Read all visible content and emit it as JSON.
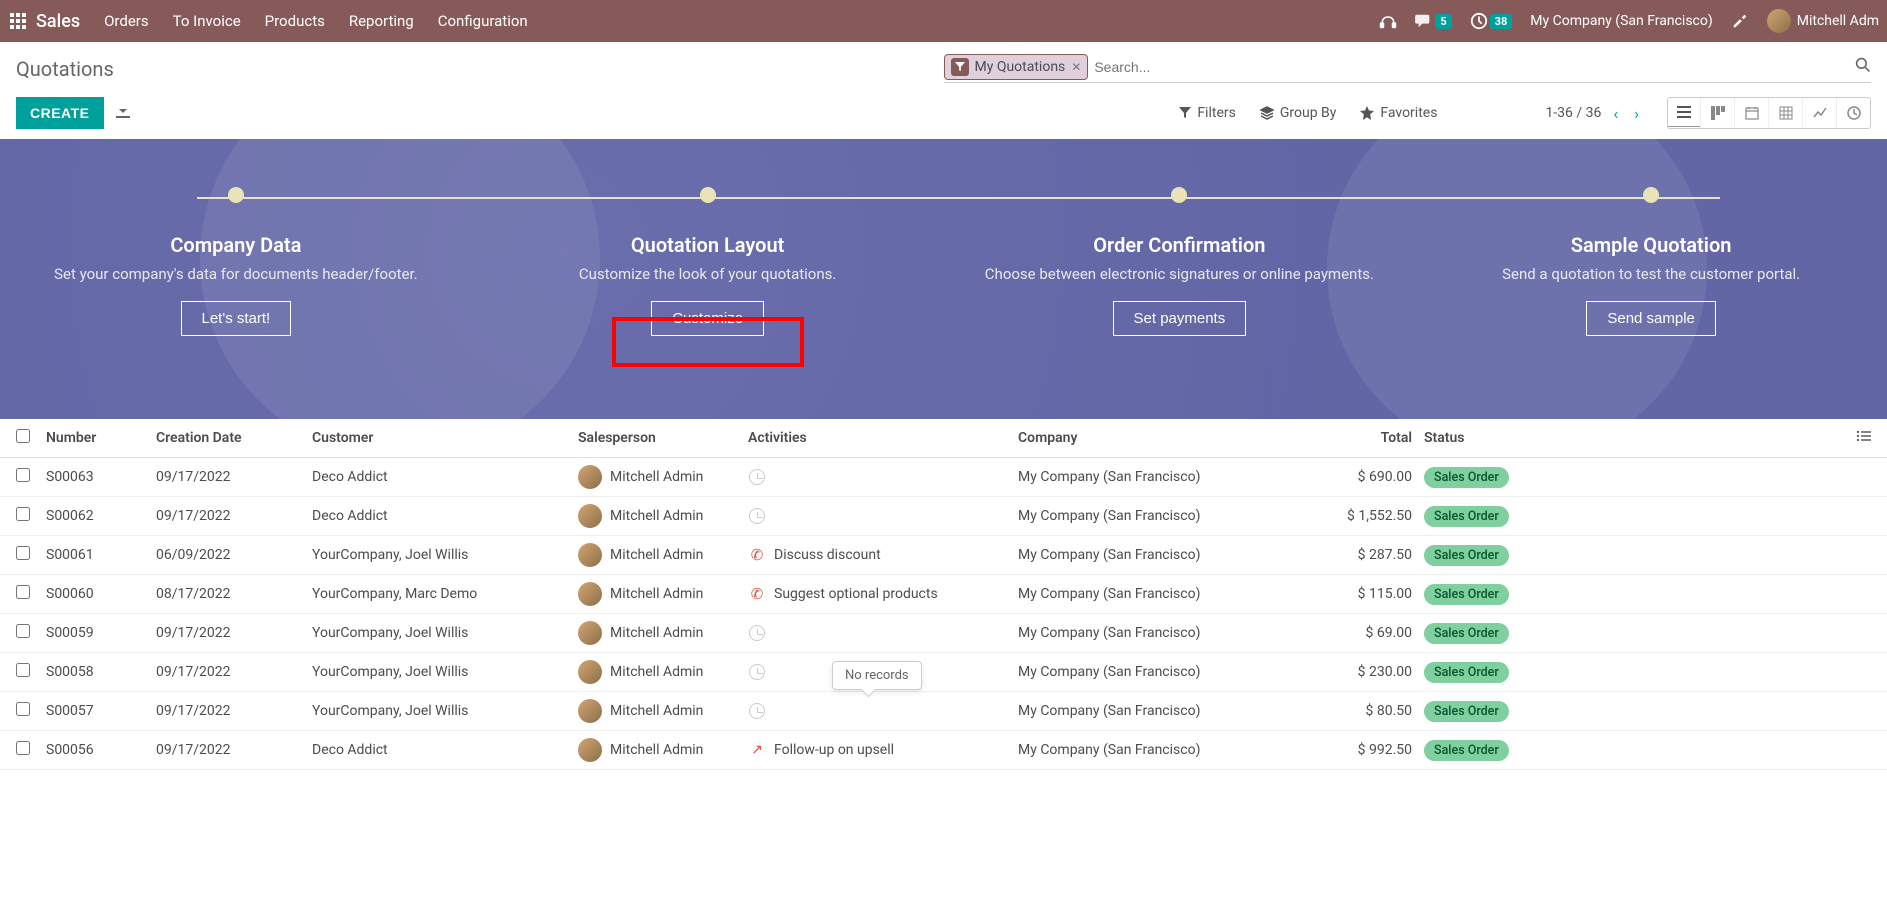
{
  "topbar": {
    "brand": "Sales",
    "menu": [
      "Orders",
      "To Invoice",
      "Products",
      "Reporting",
      "Configuration"
    ],
    "chat_badge": "5",
    "clock_badge": "38",
    "company": "My Company (San Francisco)",
    "user": "Mitchell Adm"
  },
  "page": {
    "title": "Quotations",
    "filter_chip": "My Quotations",
    "search_placeholder": "Search...",
    "create_label": "CREATE",
    "tools": {
      "filters": "Filters",
      "groupby": "Group By",
      "favorites": "Favorites"
    },
    "pager": "1-36 / 36"
  },
  "onboard": {
    "steps": [
      {
        "title": "Company Data",
        "desc": "Set your company's data for documents header/footer.",
        "btn": "Let's start!"
      },
      {
        "title": "Quotation Layout",
        "desc": "Customize the look of your quotations.",
        "btn": "Customize"
      },
      {
        "title": "Order Confirmation",
        "desc": "Choose between electronic signatures or online payments.",
        "btn": "Set payments"
      },
      {
        "title": "Sample Quotation",
        "desc": "Send a quotation to test the customer portal.",
        "btn": "Send sample"
      }
    ]
  },
  "columns": {
    "number": "Number",
    "date": "Creation Date",
    "customer": "Customer",
    "salesperson": "Salesperson",
    "activities": "Activities",
    "company": "Company",
    "total": "Total",
    "status": "Status"
  },
  "tooltip": "No records",
  "rows": [
    {
      "number": "S00063",
      "date": "09/17/2022",
      "customer": "Deco Addict",
      "salesperson": "Mitchell Admin",
      "activity_type": "clock",
      "activity_text": "",
      "company": "My Company (San Francisco)",
      "total": "$ 690.00",
      "status": "Sales Order"
    },
    {
      "number": "S00062",
      "date": "09/17/2022",
      "customer": "Deco Addict",
      "salesperson": "Mitchell Admin",
      "activity_type": "clock",
      "activity_text": "",
      "company": "My Company (San Francisco)",
      "total": "$ 1,552.50",
      "status": "Sales Order"
    },
    {
      "number": "S00061",
      "date": "06/09/2022",
      "customer": "YourCompany, Joel Willis",
      "salesperson": "Mitchell Admin",
      "activity_type": "phone",
      "activity_text": "Discuss discount",
      "company": "My Company (San Francisco)",
      "total": "$ 287.50",
      "status": "Sales Order"
    },
    {
      "number": "S00060",
      "date": "08/17/2022",
      "customer": "YourCompany, Marc Demo",
      "salesperson": "Mitchell Admin",
      "activity_type": "phone",
      "activity_text": "Suggest optional products",
      "company": "My Company (San Francisco)",
      "total": "$ 115.00",
      "status": "Sales Order"
    },
    {
      "number": "S00059",
      "date": "09/17/2022",
      "customer": "YourCompany, Joel Willis",
      "salesperson": "Mitchell Admin",
      "activity_type": "clock",
      "activity_text": "",
      "company": "My Company (San Francisco)",
      "total": "$ 69.00",
      "status": "Sales Order"
    },
    {
      "number": "S00058",
      "date": "09/17/2022",
      "customer": "YourCompany, Joel Willis",
      "salesperson": "Mitchell Admin",
      "activity_type": "clock",
      "activity_text": "",
      "company": "My Company (San Francisco)",
      "total": "$ 230.00",
      "status": "Sales Order",
      "tooltip": true
    },
    {
      "number": "S00057",
      "date": "09/17/2022",
      "customer": "YourCompany, Joel Willis",
      "salesperson": "Mitchell Admin",
      "activity_type": "clock",
      "activity_text": "",
      "company": "My Company (San Francisco)",
      "total": "$ 80.50",
      "status": "Sales Order"
    },
    {
      "number": "S00056",
      "date": "09/17/2022",
      "customer": "Deco Addict",
      "salesperson": "Mitchell Admin",
      "activity_type": "chart",
      "activity_text": "Follow-up on upsell",
      "company": "My Company (San Francisco)",
      "total": "$ 992.50",
      "status": "Sales Order"
    }
  ]
}
